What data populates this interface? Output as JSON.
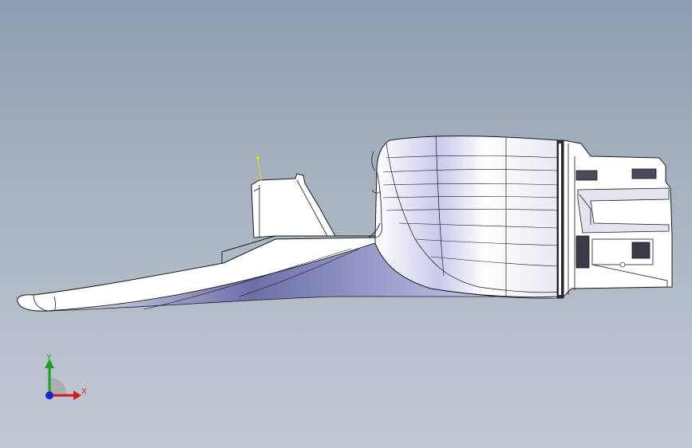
{
  "viewport": {
    "background_top": "#8e9db0",
    "background_bottom": "#c3cad4"
  },
  "model": {
    "fill": "#ffffff",
    "edge_color": "#1a1a1a",
    "shade_color": "#7a7fb8",
    "note_marker_color": "#e6e000"
  },
  "triad": {
    "x_label": "X",
    "y_label": "Y",
    "x_color": "#d21e1e",
    "y_color": "#1ea01e",
    "z_color": "#1e1ed2"
  }
}
